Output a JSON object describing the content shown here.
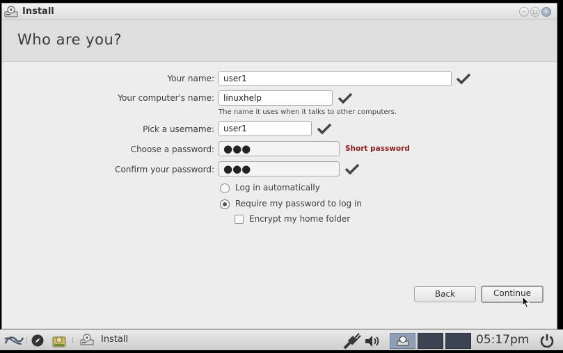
{
  "window": {
    "title": "Install",
    "controls": {
      "minimize": "–",
      "maximize": "□",
      "close": "×"
    }
  },
  "page": {
    "heading": "Who are you?"
  },
  "form": {
    "name_label": "Your name:",
    "name_value": "user1",
    "computer_label": "Your computer's name:",
    "computer_value": "linuxhelp",
    "computer_hint": "The name it uses when it talks to other computers.",
    "username_label": "Pick a username:",
    "username_value": "user1",
    "password_label": "Choose a password:",
    "password_value": "●●●",
    "password_strength": "Short password",
    "confirm_label": "Confirm your password:",
    "confirm_value": "●●●",
    "login_auto_label": "Log in automatically",
    "login_password_label": "Require my password to log in",
    "encrypt_label": "Encrypt my home folder",
    "login_mode": "require-password",
    "encrypt_home": false
  },
  "buttons": {
    "back": "Back",
    "continue": "Continue"
  },
  "taskbar": {
    "task_label": "Install",
    "clock": "05:17pm",
    "workspaces": 4,
    "active_workspace": 1
  },
  "colors": {
    "warning": "#8b1a1a",
    "accent": "#8f9fb5"
  }
}
